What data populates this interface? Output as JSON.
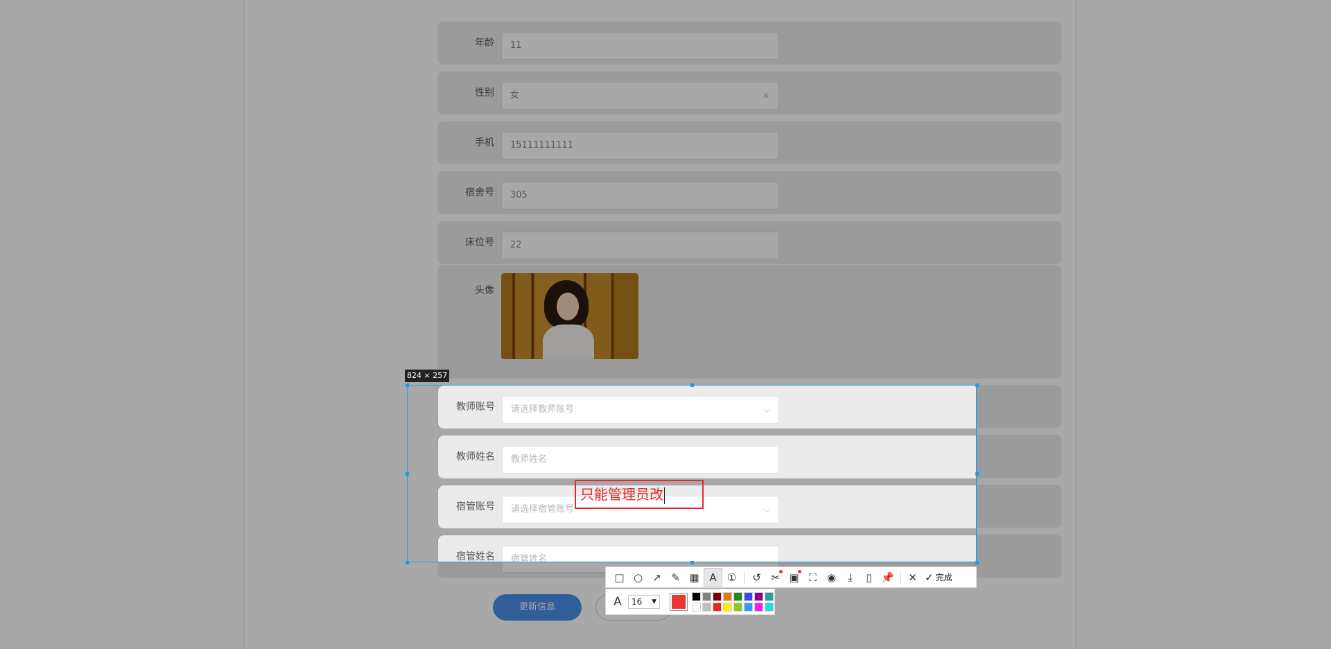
{
  "form": {
    "rows": [
      {
        "label": "年龄",
        "value": "11",
        "placeholder": false,
        "has_chevron": false
      },
      {
        "label": "性别",
        "value": "女",
        "placeholder": false,
        "has_chevron": true,
        "chevron": "×"
      },
      {
        "label": "手机",
        "value": "15111111111",
        "placeholder": false,
        "has_chevron": false
      },
      {
        "label": "宿舍号",
        "value": "305",
        "placeholder": false,
        "has_chevron": false
      },
      {
        "label": "床位号",
        "value": "22",
        "placeholder": false,
        "has_chevron": false
      }
    ],
    "avatar_label": "头像",
    "lower_rows": [
      {
        "label": "教师账号",
        "value": "请选择教师账号",
        "placeholder": true,
        "has_chevron": true,
        "chevron": "⌵"
      },
      {
        "label": "教师姓名",
        "value": "教师姓名",
        "placeholder": true,
        "has_chevron": false
      },
      {
        "label": "宿管账号",
        "value": "请选择宿管账号",
        "placeholder": true,
        "has_chevron": true,
        "chevron": "⌵"
      },
      {
        "label": "宿管姓名",
        "value": "宿管姓名",
        "placeholder": true,
        "has_chevron": false
      }
    ],
    "update_button": "更新信息"
  },
  "screenshot_tool": {
    "size_label": "824 × 257",
    "annotation_text": "只能管理员改",
    "font_size": "16",
    "current_color": "#ee3333",
    "done_label": "完成",
    "tools": [
      "rect-icon",
      "ellipse-icon",
      "arrow-icon",
      "pencil-icon",
      "mosaic-icon",
      "text-icon",
      "number-icon",
      "undo-icon",
      "cut-icon",
      "ocr-icon",
      "scroll-capture-icon",
      "record-icon",
      "download-icon",
      "copy-icon",
      "pin-icon",
      "close-icon"
    ],
    "palette": [
      "#000000",
      "#808080",
      "#800000",
      "#e07b10",
      "#228b22",
      "#3a4fd8",
      "#8b008b",
      "#20a0a0",
      "#ffffff",
      "#c0c0c0",
      "#ee2222",
      "#ffee00",
      "#88cc22",
      "#3399ff",
      "#ee22ee",
      "#22dddd"
    ]
  }
}
